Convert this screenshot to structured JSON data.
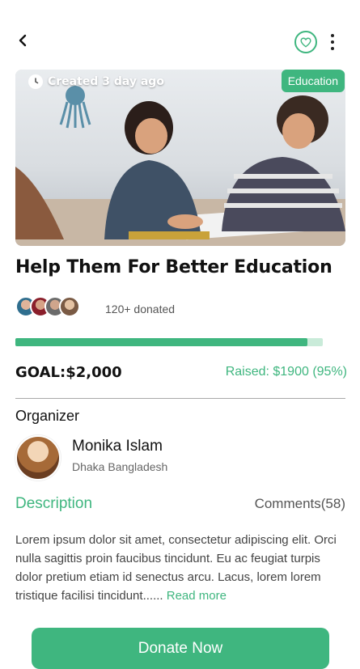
{
  "header": {
    "back_icon": "chevron-left-icon",
    "favorite_icon": "heart-icon",
    "more_icon": "more-vertical-icon"
  },
  "hero": {
    "created_text": "Created 3 day ago",
    "category": "Education"
  },
  "campaign": {
    "title": "Help Them For Better Education",
    "donated_text": "120+ donated",
    "progress_fraction": 0.95,
    "goal_text": "GOAL:$2,000",
    "raised_text": "Raised: $1900 (95%)"
  },
  "organizer": {
    "label": "Organizer",
    "name": "Monika Islam",
    "location": "Dhaka Bangladesh"
  },
  "tabs": {
    "description": "Description",
    "comments": "Comments(58)"
  },
  "description": {
    "text": "Lorem ipsum dolor sit amet, consectetur adipiscing elit. Orci nulla sagittis proin faucibus tincidunt. Eu ac feugiat turpis dolor pretium etiam id senectus arcu. Lacus, lorem lorem tristique facilisi tincidunt...... ",
    "read_more": "Read more"
  },
  "cta": {
    "donate_label": "Donate Now"
  },
  "colors": {
    "accent": "#3fb67f",
    "progress_track": "#c9ebd9"
  }
}
